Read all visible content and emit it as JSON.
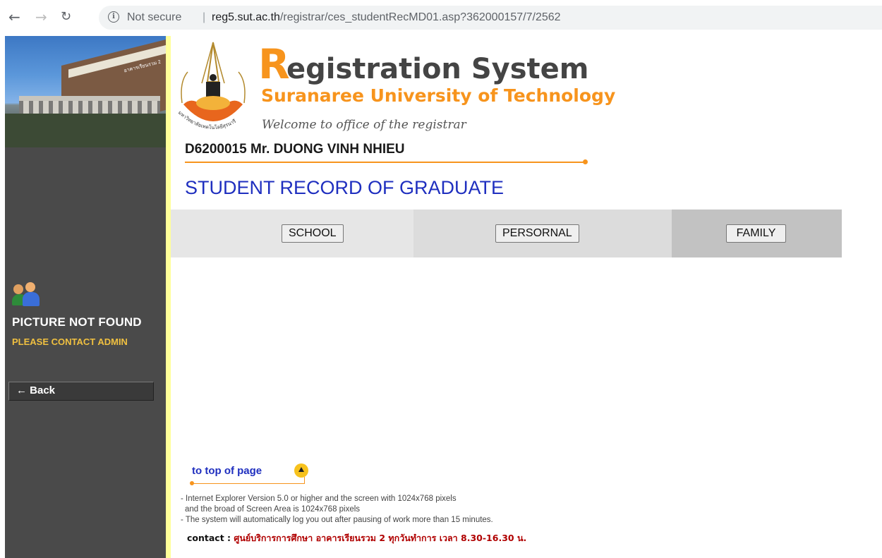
{
  "browser": {
    "security_label": "Not secure",
    "separator": "|",
    "url_host": "reg5.sut.ac.th",
    "url_path": "/registrar/ces_studentRecMD01.asp?362000157/7/2562"
  },
  "sidebar": {
    "picture_not_found": "PICTURE NOT FOUND",
    "contact_admin": "PLEASE CONTACT ADMIN",
    "back_label": "← Back",
    "building_sign": "อาคารเรียนรวม 2"
  },
  "header": {
    "title_initial": "R",
    "title_rest": "egistration System",
    "subtitle": "Suranaree University of Technology",
    "welcome": "Welcome to office of the registrar",
    "student": "D6200015 Mr. DUONG VINH NHIEU",
    "page_title": "STUDENT RECORD OF GRADUATE",
    "seal_text": "มหาวิทยาลัยเทคโนโลยีสุรนารี"
  },
  "tabs": {
    "school": "SCHOOL",
    "personal": "PERSORNAL",
    "family": "FAMILY"
  },
  "footer": {
    "to_top": "to top of page",
    "note1": "- Internet Explorer Version 5.0 or higher and the screen with 1024x768 pixels",
    "note2": "  and the broad of Screen Area is 1024x768 pixels",
    "note3": "- The system will automatically log you out after pausing of work more than 15 minutes.",
    "contact_label": "contact :",
    "contact_value": "ศูนย์บริการการศึกษา อาคารเรียนรวม 2 ทุกวันทำการ เวลา 8.30-16.30 น."
  },
  "colors": {
    "accent_orange": "#f7941d",
    "title_blue": "#1f2fbf",
    "sidebar_bg": "#4a4a4a",
    "strip_yellow": "#ffff99",
    "contact_red": "#b00000"
  }
}
